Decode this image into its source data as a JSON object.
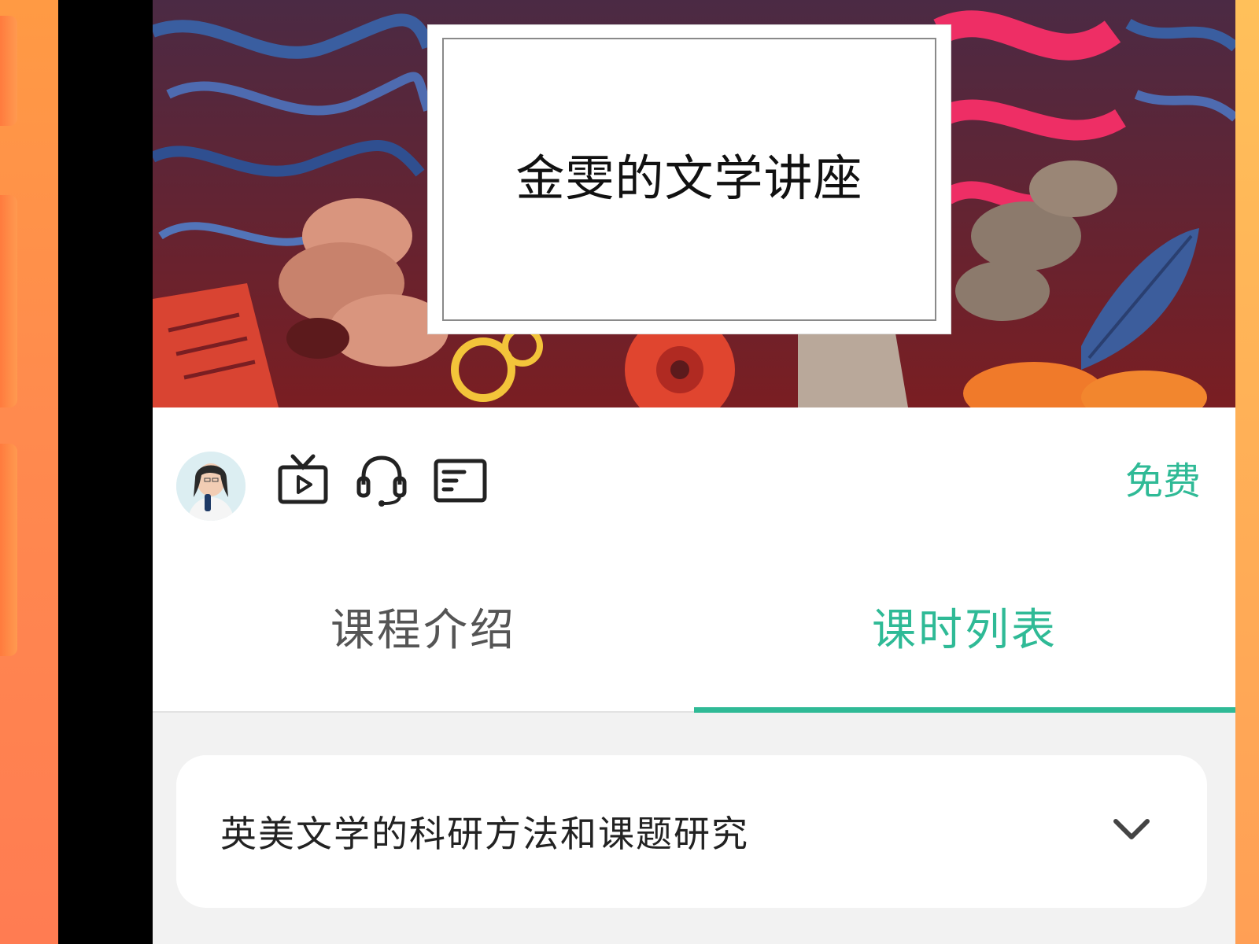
{
  "banner": {
    "title": "金雯的文学讲座"
  },
  "course_meta": {
    "price": "免费",
    "icons": [
      "tv-icon",
      "headset-icon",
      "document-icon"
    ]
  },
  "tabs": [
    {
      "label": "课程介绍",
      "active": false
    },
    {
      "label": "课时列表",
      "active": true
    }
  ],
  "lessons": [
    {
      "title": "英美文学的科研方法和课题研究"
    }
  ],
  "colors": {
    "accent": "#2fba96",
    "inactive_tab": "#555555",
    "background": "#f2f2f2"
  }
}
